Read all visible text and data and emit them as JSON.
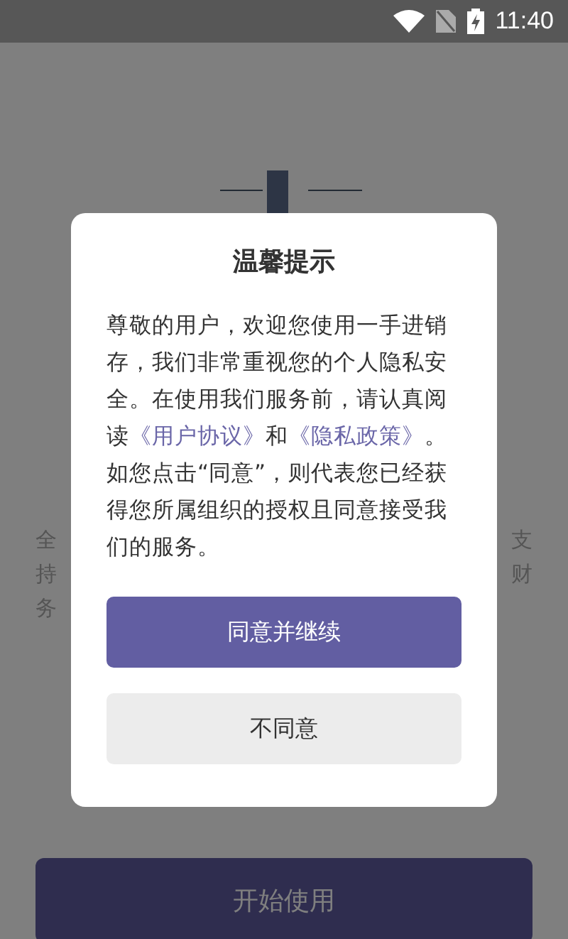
{
  "status_bar": {
    "time": "11:40"
  },
  "background": {
    "description_left": [
      "全",
      "持",
      "务"
    ],
    "description_right": [
      "支",
      "财"
    ],
    "start_button": "开始使用"
  },
  "dialog": {
    "title": "温馨提示",
    "message": [
      {
        "kind": "text",
        "text": "尊敬的用户，欢迎您使用一手进销存，我们非常重视您的个人隐私安全。在使用我们服务前，请认真阅读"
      },
      {
        "kind": "link",
        "text": "《用户协议》"
      },
      {
        "kind": "text",
        "text": "和"
      },
      {
        "kind": "link",
        "text": "《隐私政策》"
      },
      {
        "kind": "text",
        "text": "。"
      },
      {
        "kind": "break"
      },
      {
        "kind": "text",
        "text": "如您点击“同意”，则代表您已经获得您所属组织的授权且同意接受我们的服务。"
      }
    ],
    "buttons": [
      {
        "label": "同意并继续",
        "kind": "primary"
      },
      {
        "label": "不同意",
        "kind": "secondary"
      }
    ]
  }
}
